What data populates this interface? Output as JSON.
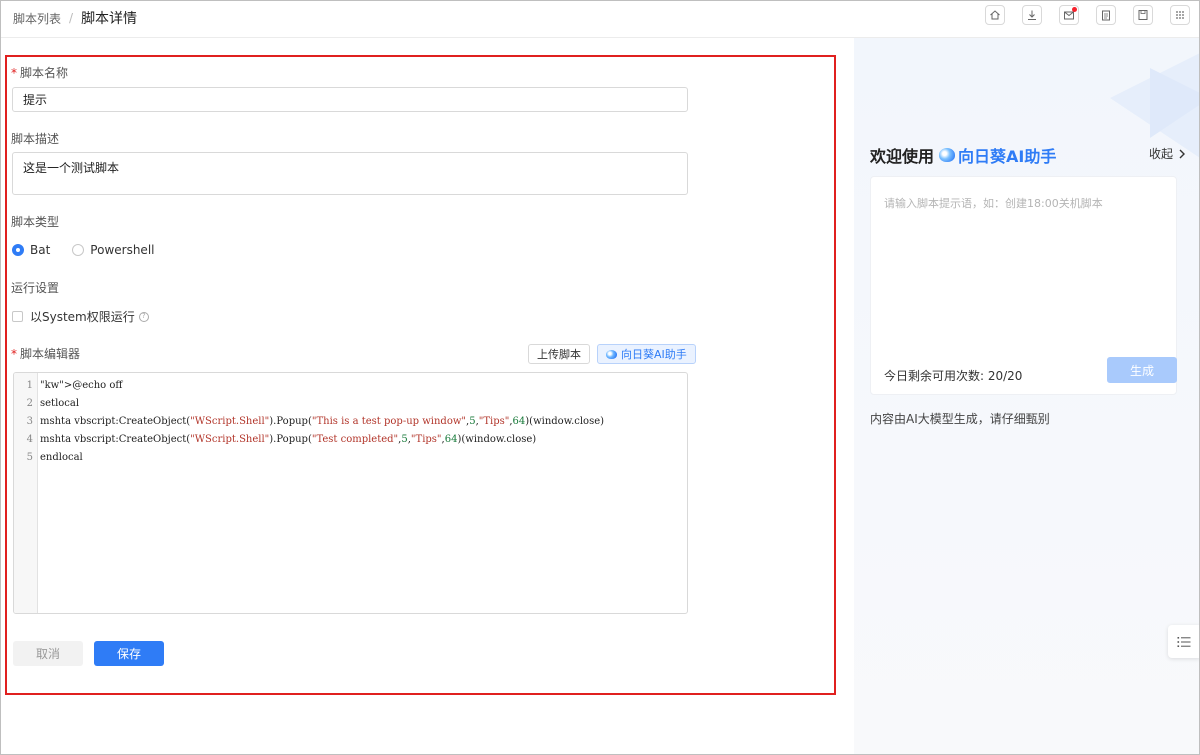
{
  "header": {
    "breadcrumb_parent": "脚本列表",
    "breadcrumb_sep": "/",
    "breadcrumb_current": "脚本详情",
    "toolbar_icons": [
      "home-icon",
      "download-icon",
      "message-icon",
      "clipboard-icon",
      "save-icon",
      "apps-icon"
    ]
  },
  "form": {
    "name_label": "脚本名称",
    "name_value": "提示",
    "desc_label": "脚本描述",
    "desc_value": "这是一个测试脚本",
    "type_label": "脚本类型",
    "type_options": [
      "Bat",
      "Powershell"
    ],
    "type_selected": "Bat",
    "run_label": "运行设置",
    "run_option": "以System权限运行",
    "run_checked": false,
    "editor_label": "脚本编辑器",
    "upload_button": "上传脚本",
    "ai_button": "向日葵AI助手",
    "required_mark": "*",
    "code_lines": [
      "@echo off",
      "setlocal",
      "mshta vbscript:CreateObject(\"WScript.Shell\").Popup(\"This is a test pop-up window\",5,\"Tips\",64)(window.close)",
      "mshta vbscript:CreateObject(\"WScript.Shell\").Popup(\"Test completed\",5,\"Tips\",64)(window.close)",
      "endlocal"
    ],
    "cancel_button": "取消",
    "save_button": "保存"
  },
  "assistant": {
    "welcome": "欢迎使用",
    "brand": "向日葵AI助手",
    "collapse": "收起",
    "prompt_placeholder": "请输入脚本提示语，如：创建18:00关机脚本",
    "remaining": "今日剩余可用次数: 20/20",
    "generate_button": "生成",
    "disclaimer": "内容由AI大模型生成，请仔细甄别"
  },
  "colors": {
    "accent": "#2f7cf6",
    "required": "#e0201f",
    "highlight_border": "#e0201f"
  }
}
